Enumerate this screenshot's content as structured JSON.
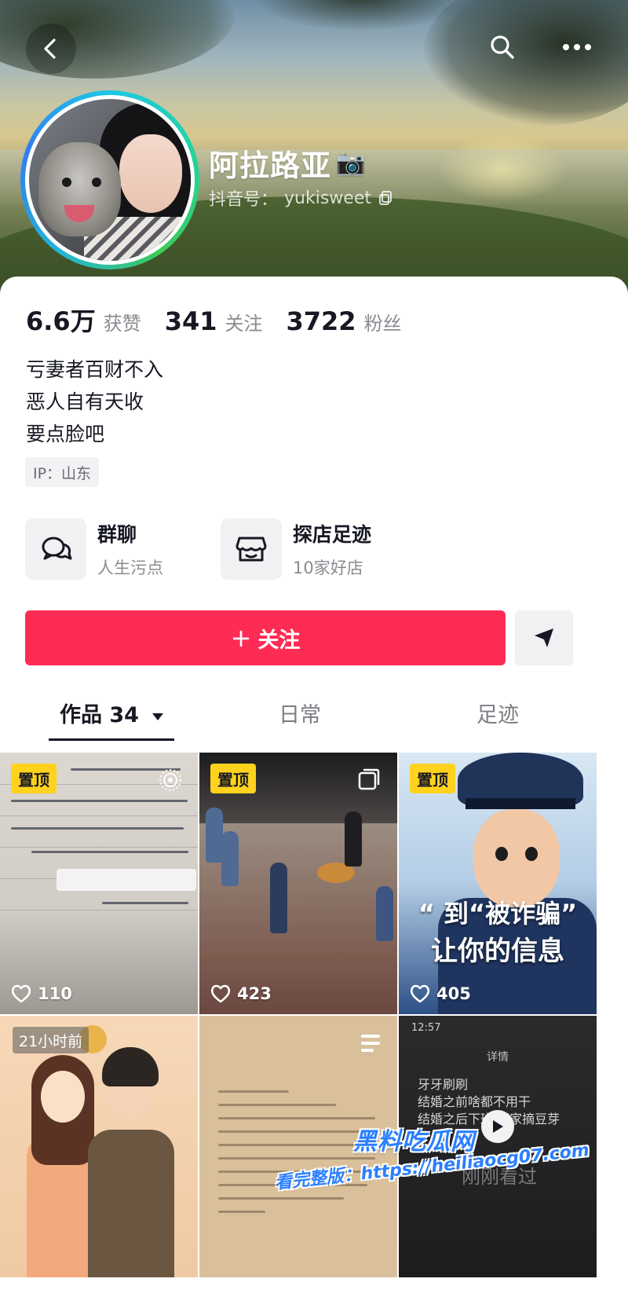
{
  "header": {
    "username": "阿拉路亚",
    "camera_emoji": "📷",
    "douyin_id_label": "抖音号：",
    "douyin_id": "yukisweet"
  },
  "stats": [
    {
      "value": "6.6万",
      "label": "获赞"
    },
    {
      "value": "341",
      "label": "关注"
    },
    {
      "value": "3722",
      "label": "粉丝"
    }
  ],
  "bio": [
    "亏妻者百财不入",
    "恶人自有天收",
    "要点脸吧"
  ],
  "ip_tag": "IP：山东",
  "features": [
    {
      "title": "群聊",
      "subtitle": "人生污点",
      "icon": "chat-bubbles-icon"
    },
    {
      "title": "探店足迹",
      "subtitle": "10家好店",
      "icon": "shop-icon"
    }
  ],
  "follow_button": {
    "label": "关注",
    "plus": "+"
  },
  "tabs": [
    {
      "label": "作品 34",
      "active": true
    },
    {
      "label": "日常",
      "active": false
    },
    {
      "label": "足迹",
      "active": false
    }
  ],
  "videos": [
    {
      "pinned_label": "置顶",
      "likes": "110"
    },
    {
      "pinned_label": "置顶",
      "likes": "423"
    },
    {
      "pinned_label": "置顶",
      "likes": "405",
      "caption_top": "“ 到“被诈骗”",
      "caption_bottom": "让你的信息"
    },
    {
      "time_label": "21小时前"
    },
    {},
    {
      "status_time": "12:57",
      "header": "详情",
      "lines": [
        "牙牙刷刷",
        "结婚之前啥都不用干",
        "结婚之后下班 回家摘豆芽"
      ],
      "big_text": "刚刚看过"
    }
  ],
  "watermark": {
    "title": "黑料吃瓜网",
    "url": "看完整版：https://heiliaocg07.com"
  },
  "colors": {
    "accent": "#fe2c55",
    "pin_yellow": "#ffd21e",
    "text_primary": "#161823",
    "text_secondary": "#8a8b91"
  }
}
